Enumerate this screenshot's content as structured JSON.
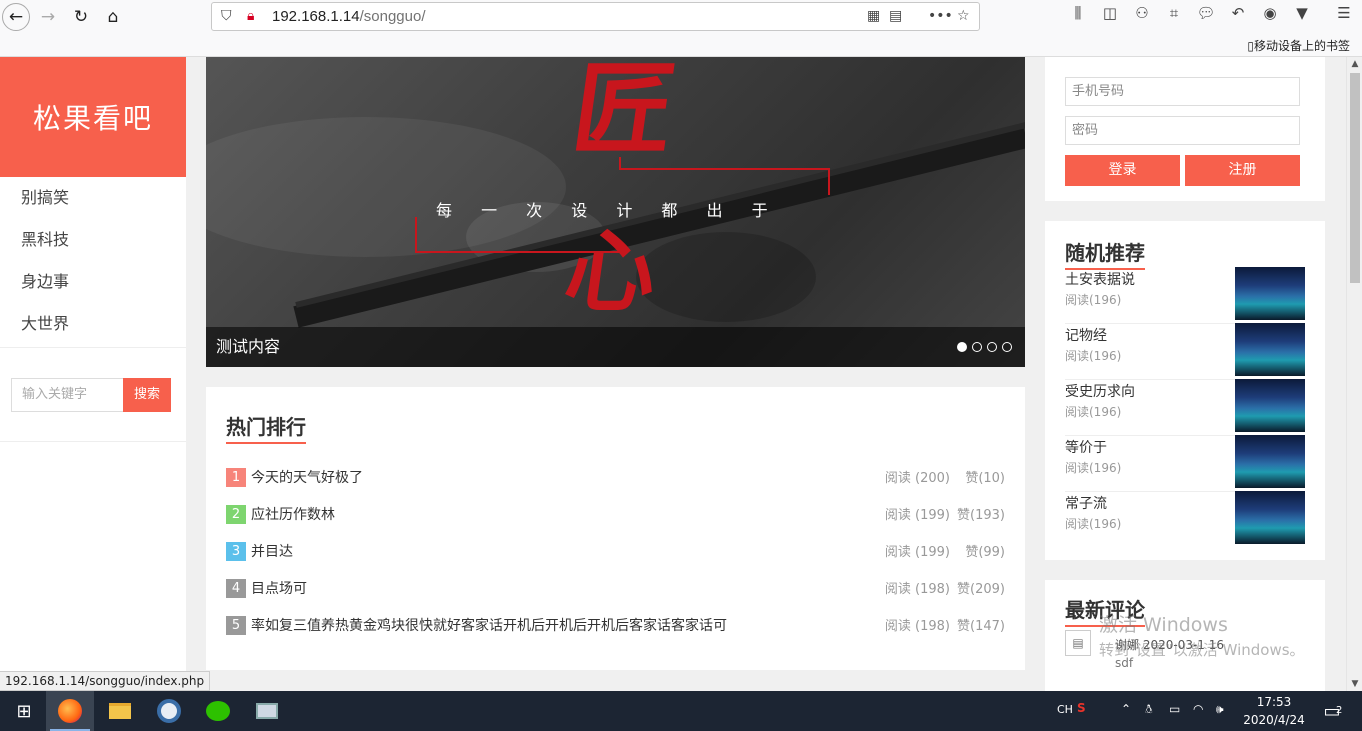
{
  "browser": {
    "url_host": "192.168.1.14",
    "url_path": "/songguo/",
    "bookmark_label": "移动设备上的书签"
  },
  "site": {
    "logo": "松果看吧",
    "nav": [
      "别搞笑",
      "黑科技",
      "身边事",
      "大世界"
    ],
    "search_placeholder": "输入关键字",
    "search_button": "搜索"
  },
  "banner": {
    "big_char_top": "匠",
    "big_char_bottom": "心",
    "slogan": "每 一 次 设 计 都 出 于",
    "caption": "测试内容",
    "dots": 4,
    "active_dot": 0
  },
  "hot": {
    "title": "热门排行",
    "items": [
      {
        "rank": "1",
        "title": "今天的天气好极了",
        "reads": "阅读 (200)",
        "likes": "赞(10)",
        "color": "#f7847a"
      },
      {
        "rank": "2",
        "title": "应社历作数林",
        "reads": "阅读 (199)",
        "likes": "赞(193)",
        "color": "#7ed56f"
      },
      {
        "rank": "3",
        "title": "并目达",
        "reads": "阅读 (199)",
        "likes": "赞(99)",
        "color": "#5bc0eb"
      },
      {
        "rank": "4",
        "title": "目点场可",
        "reads": "阅读 (198)",
        "likes": "赞(209)",
        "color": "#999999"
      },
      {
        "rank": "5",
        "title": "率如复三值养热黄金鸡块很快就好客家话开机后开机后开机后客家话客家话可",
        "reads": "阅读 (198)",
        "likes": "赞(147)",
        "color": "#999999"
      }
    ]
  },
  "login": {
    "phone_placeholder": "手机号码",
    "password_placeholder": "密码",
    "login_button": "登录",
    "register_button": "注册"
  },
  "recommend": {
    "title": "随机推荐",
    "items": [
      {
        "title": "土安表据说",
        "reads": "阅读(196)"
      },
      {
        "title": "记物经",
        "reads": "阅读(196)"
      },
      {
        "title": "受史历求向",
        "reads": "阅读(196)"
      },
      {
        "title": "等价于",
        "reads": "阅读(196)"
      },
      {
        "title": "常子流",
        "reads": "阅读(196)"
      }
    ]
  },
  "comments": {
    "title": "最新评论",
    "user_time": "谢娜 2020-03-1 16",
    "body": "sdf"
  },
  "watermark": {
    "line1": "激活 Windows",
    "line2": "转到\"设置\"以激活 Windows。"
  },
  "status_url": "192.168.1.14/songguo/index.php",
  "taskbar": {
    "ime": "CH",
    "time": "17:53",
    "date": "2020/4/24",
    "notif_count": "2"
  },
  "colors": {
    "accent": "#f7604c",
    "banner_red": "#c8161d"
  }
}
